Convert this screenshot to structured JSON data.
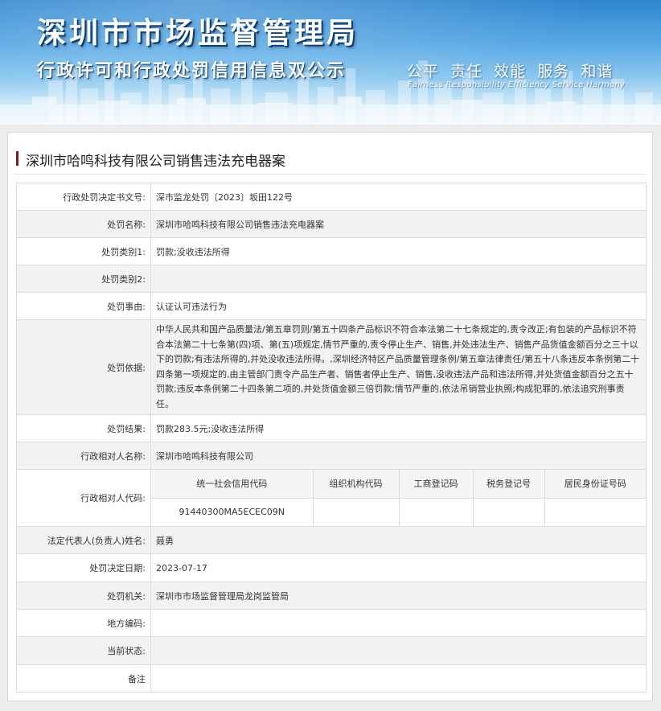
{
  "banner": {
    "title": "深圳市市场监督管理局",
    "subtitle": "行政许可和行政处罚信用信息双公示",
    "slogan_cn": "公平  责任  效能  服务  和谐",
    "slogan_en": "Fairness Responsibility Efficiency Service Harmony"
  },
  "case": {
    "title": "深圳市哈鸣科技有限公司销售违法充电器案"
  },
  "fields": {
    "doc_no": {
      "label": "行政处罚决定书文号:",
      "value": "深市监龙处罚〔2023〕坂田122号"
    },
    "name": {
      "label": "处罚名称:",
      "value": "深圳市哈鸣科技有限公司销售违法充电器案"
    },
    "type1": {
      "label": "处罚类别1:",
      "value": "罚款;没收违法所得"
    },
    "type2": {
      "label": "处罚类别2:",
      "value": ""
    },
    "reason": {
      "label": "处罚事由:",
      "value": "认证认可违法行为"
    },
    "basis": {
      "label": "处罚依据:",
      "value": "中华人民共和国产品质量法/第五章罚则/第五十四条产品标识不符合本法第二十七条规定的,责令改正;有包装的产品标识不符合本法第二十七条第(四)项、第(五)项规定,情节严重的,责令停止生产、销售,并处违法生产、销售产品货值金额百分之三十以下的罚款;有违法所得的,并处没收违法所得。,深圳经济特区产品质量管理条例/第五章法律责任/第五十八条违反本条例第二十四条第一项规定的,由主管部门责令产品生产者、销售者停止生产、销售,没收违法产品和违法所得,并处货值金额百分之五十罚款;违反本条例第二十四条第二项的,并处货值金额三倍罚款;情节严重的,依法吊销营业执照;构成犯罪的,依法追究刑事责任。"
    },
    "result": {
      "label": "处罚结果:",
      "value": "罚款283.5元;没收违法所得"
    },
    "party": {
      "label": "行政相对人名称:",
      "value": "深圳市哈鸣科技有限公司"
    },
    "party_code": {
      "label": "行政相对人代码:",
      "headers": [
        "统一社会信用代码",
        "组织机构代码",
        "工商登记码",
        "税务登记号",
        "居民身份证号码"
      ],
      "values": [
        "91440300MA5ECEC09N",
        "",
        "",
        "",
        ""
      ]
    },
    "legal_rep": {
      "label": "法定代表人(负责人)姓名:",
      "value": "聂勇"
    },
    "date": {
      "label": "处罚决定日期:",
      "value": "2023-07-17"
    },
    "authority": {
      "label": "处罚机关:",
      "value": "深圳市市场监督管理局龙岗监管局"
    },
    "area_code": {
      "label": "地方编码:",
      "value": ""
    },
    "status": {
      "label": "当前状态:",
      "value": ""
    },
    "remark": {
      "label": "备注",
      "value": ""
    }
  }
}
